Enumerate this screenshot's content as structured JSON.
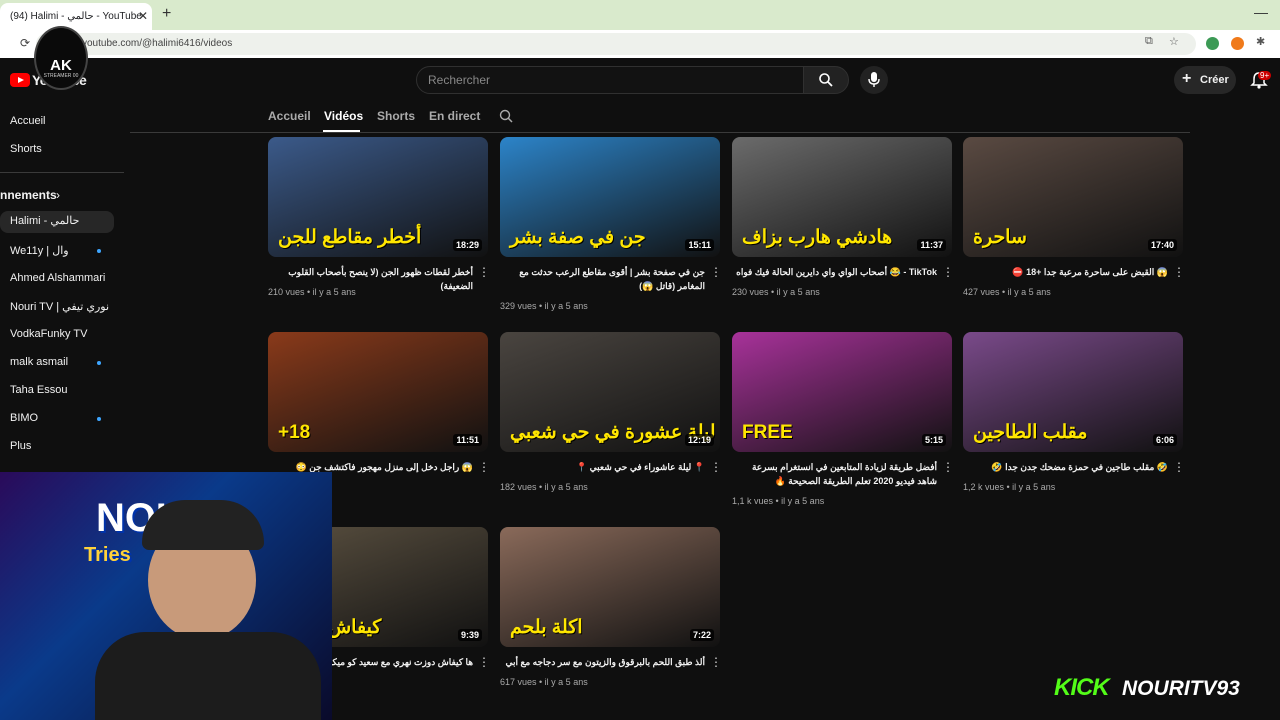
{
  "browser": {
    "tab_title": "(94) Halimi - حالمي - YouTube",
    "tab_close": "✕",
    "new_tab": "+",
    "minimize": "—",
    "url": "youtube.com/@halimi6416/videos"
  },
  "overlay": {
    "logo_main": "AK",
    "logo_sub": "STREAMER 00",
    "webcam_name": "NOU",
    "webcam_sub": "Tries",
    "kick_logo": "KICK",
    "kick_channel": "NOURITV93"
  },
  "header": {
    "logo_text": "YouTube",
    "search_placeholder": "Rechercher",
    "create_label": "Créer",
    "create_plus": "+",
    "notification_count": "9+"
  },
  "sidebar": {
    "items": [
      {
        "label": "Accueil"
      },
      {
        "label": "Shorts"
      }
    ],
    "subscriptions_heading": "nnements",
    "subscriptions": [
      {
        "label": "Halimi - حالمي",
        "active": true,
        "dot": false
      },
      {
        "label": "We11y | وال",
        "dot": true
      },
      {
        "label": "Ahmed Alshammari",
        "dot": false
      },
      {
        "label": "Nouri TV | نوري تيفي",
        "dot": false
      },
      {
        "label": "VodkaFunky TV",
        "dot": false
      },
      {
        "label": "malk asmail",
        "dot": true
      },
      {
        "label": "Taha Essou",
        "dot": false
      },
      {
        "label": "BIMO",
        "dot": true
      },
      {
        "label": "Plus",
        "dot": false
      }
    ]
  },
  "channel_tabs": [
    {
      "label": "Accueil",
      "active": false
    },
    {
      "label": "Vidéos",
      "active": true
    },
    {
      "label": "Shorts",
      "active": false
    },
    {
      "label": "En direct",
      "active": false
    }
  ],
  "videos": [
    {
      "title": "أخطر لقطات ظهور الجن (لا ينصح بأصحاب القلوب الضعيفة)",
      "meta": "210 vues • il y a 5 ans",
      "duration": "18:29",
      "overlay": "أخطر مقاطع للجن",
      "color": "#3b5a8a"
    },
    {
      "title": "جن في صفحة بشر | أقوى مقاطع الرعب حدثت مع المغامر (قاتل 😱)",
      "meta": "329 vues • il y a 5 ans",
      "duration": "15:11",
      "overlay": "جن في صفة بشر",
      "color": "#2c84c9"
    },
    {
      "title": "TikTok - 😂 أصحاب الواي واي دايرين الحالة فيك فواه",
      "meta": "230 vues • il y a 5 ans",
      "duration": "11:37",
      "overlay": "هادشي هارب بزاف",
      "color": "#6b6b6b"
    },
    {
      "title": "😱 القبض على ساحرة مرعبة جدا +18 ⛔",
      "meta": "427 vues • il y a 5 ans",
      "duration": "17:40",
      "overlay": "ساحرة",
      "color": "#5a4a42"
    },
    {
      "title": "😱 راجل دخل إلى منزل مهجور فاكتشف جن 😳",
      "meta": "5 ans",
      "duration": "11:51",
      "overlay": "+18",
      "color": "#8a3a1a"
    },
    {
      "title": "📍 ليلة عاشوراء في حي شعبي 📍",
      "meta": "182 vues • il y a 5 ans",
      "duration": "12:19",
      "overlay": "ليلة عشورة في حي شعبي",
      "color": "#4a4540"
    },
    {
      "title": "أفضل طريقة لزيادة المتابعين في انستغرام بسرعة شاهد فيديو 2020 تعلم الطريقة الصحيحة 🔥",
      "meta": "1,1 k vues • il y a 5 ans",
      "duration": "5:15",
      "overlay": "FREE",
      "color": "#a8329a"
    },
    {
      "title": "🤣 مقلب طاجين في حمزة مضحك جدن جدا 🤣",
      "meta": "1,2 k vues • il y a 5 ans",
      "duration": "6:06",
      "overlay": "مقلب الطاجين",
      "color": "#7a4a8a"
    },
    {
      "title": "ها كيفاش دوزت نهري مع سعيد كو ميكه ...",
      "meta": "ans",
      "duration": "9:39",
      "overlay": "كيفاش دوزت",
      "color": "#5a5040"
    },
    {
      "title": "ألذ طبق اللحم بالبرقوق والزيتون مع سر دجاجه مع أبي",
      "meta": "617 vues • il y a 5 ans",
      "duration": "7:22",
      "overlay": "اكلة بلحم",
      "color": "#8a6a5a"
    }
  ]
}
